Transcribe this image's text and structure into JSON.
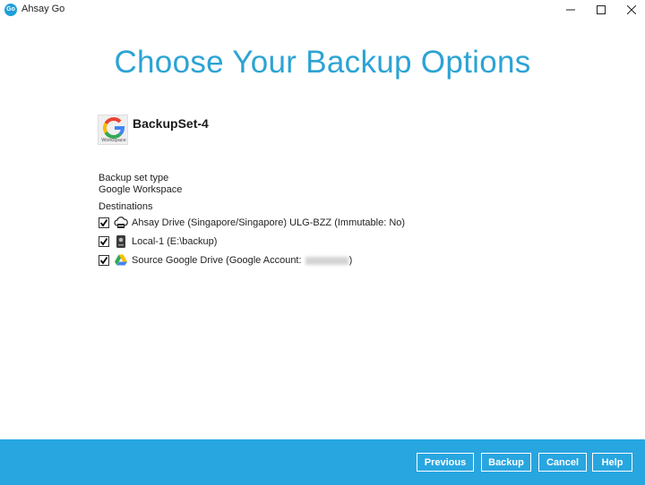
{
  "window": {
    "app_logo_text": "Go",
    "title": "Ahsay Go"
  },
  "page": {
    "heading": "Choose Your Backup Options"
  },
  "backup_set": {
    "name": "BackupSet-4",
    "logo_caption": "Workspace"
  },
  "set_type": {
    "label": "Backup set type",
    "value": "Google Workspace"
  },
  "destinations": {
    "label": "Destinations",
    "items": [
      {
        "label": "Ahsay Drive (Singapore/Singapore) ULG-BZZ (Immutable: No)",
        "checked": true,
        "icon": "cloud-drive-icon"
      },
      {
        "label": "Local-1 (E:\\backup)",
        "checked": true,
        "icon": "local-drive-icon"
      },
      {
        "label_prefix": "Source Google Drive (Google Account: ",
        "label_suffix": ")",
        "checked": true,
        "icon": "google-drive-icon"
      }
    ]
  },
  "footer": {
    "previous": "Previous",
    "backup": "Backup",
    "cancel": "Cancel",
    "help": "Help"
  },
  "colors": {
    "accent": "#2ca3d4",
    "footer": "#28a6e0"
  }
}
